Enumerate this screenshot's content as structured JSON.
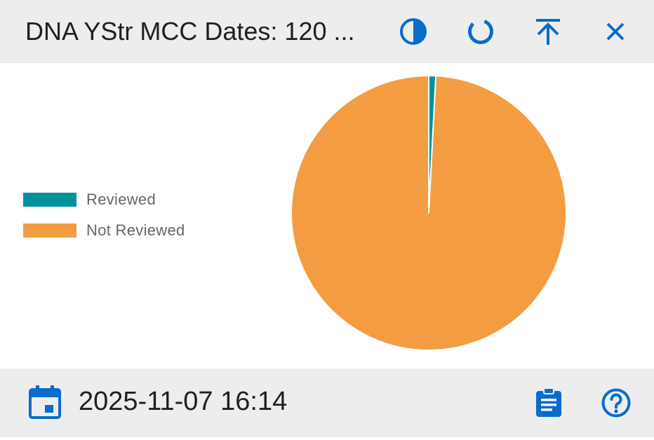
{
  "header": {
    "title": "DNA YStr MCC Dates: 120 ...",
    "icons": [
      "contrast-icon",
      "refresh-icon",
      "pin-to-top-icon",
      "close-icon"
    ]
  },
  "colors": {
    "accent": "#0a6cc9",
    "reviewed": "#00919b",
    "not_reviewed": "#f39c42",
    "bar_bg": "#ededed"
  },
  "legend": [
    {
      "label": "Reviewed",
      "color": "#00919b"
    },
    {
      "label": "Not Reviewed",
      "color": "#f39c42"
    }
  ],
  "chart_data": {
    "type": "pie",
    "categories": [
      "Reviewed",
      "Not Reviewed"
    ],
    "values": [
      1,
      120
    ],
    "colors": [
      "#00919b",
      "#f39c42"
    ],
    "legend_position": "left"
  },
  "footer": {
    "timestamp": "2025-11-07 16:14",
    "icons": [
      "calendar-icon",
      "clipboard-icon",
      "help-icon"
    ]
  }
}
